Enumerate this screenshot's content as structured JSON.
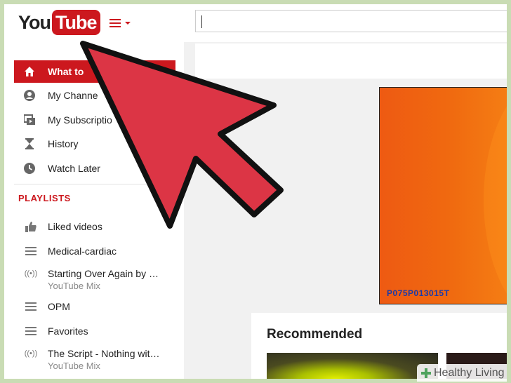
{
  "header": {
    "logo_you": "You",
    "logo_tube": "Tube",
    "search_placeholder": ""
  },
  "sidebar": {
    "nav": [
      {
        "label": "What to",
        "icon": "home-icon"
      },
      {
        "label": "My Channe",
        "icon": "person-icon"
      },
      {
        "label": "My Subscriptio",
        "icon": "subscriptions-icon"
      },
      {
        "label": "History",
        "icon": "hourglass-icon"
      },
      {
        "label": "Watch Later",
        "icon": "clock-icon"
      }
    ],
    "playlists_title": "PLAYLISTS",
    "playlists": [
      {
        "label": "Liked videos",
        "icon": "thumbs-up-icon",
        "sub": ""
      },
      {
        "label": "Medical-cardiac",
        "icon": "playlist-icon",
        "sub": ""
      },
      {
        "label": "Starting Over Again by …",
        "icon": "mix-icon",
        "sub": "YouTube Mix"
      },
      {
        "label": "OPM",
        "icon": "playlist-icon",
        "sub": ""
      },
      {
        "label": "Favorites",
        "icon": "playlist-icon",
        "sub": ""
      },
      {
        "label": "The Script - Nothing wit…",
        "icon": "mix-icon",
        "sub": "YouTube Mix"
      }
    ]
  },
  "main": {
    "banner_code": "P075P013015T",
    "recommended_title": "Recommended"
  },
  "watermark": {
    "text": "Healthy Living"
  },
  "colors": {
    "brand_red": "#cc181e",
    "arrow_red": "#dc3545",
    "banner_orange": "#ef6410"
  }
}
